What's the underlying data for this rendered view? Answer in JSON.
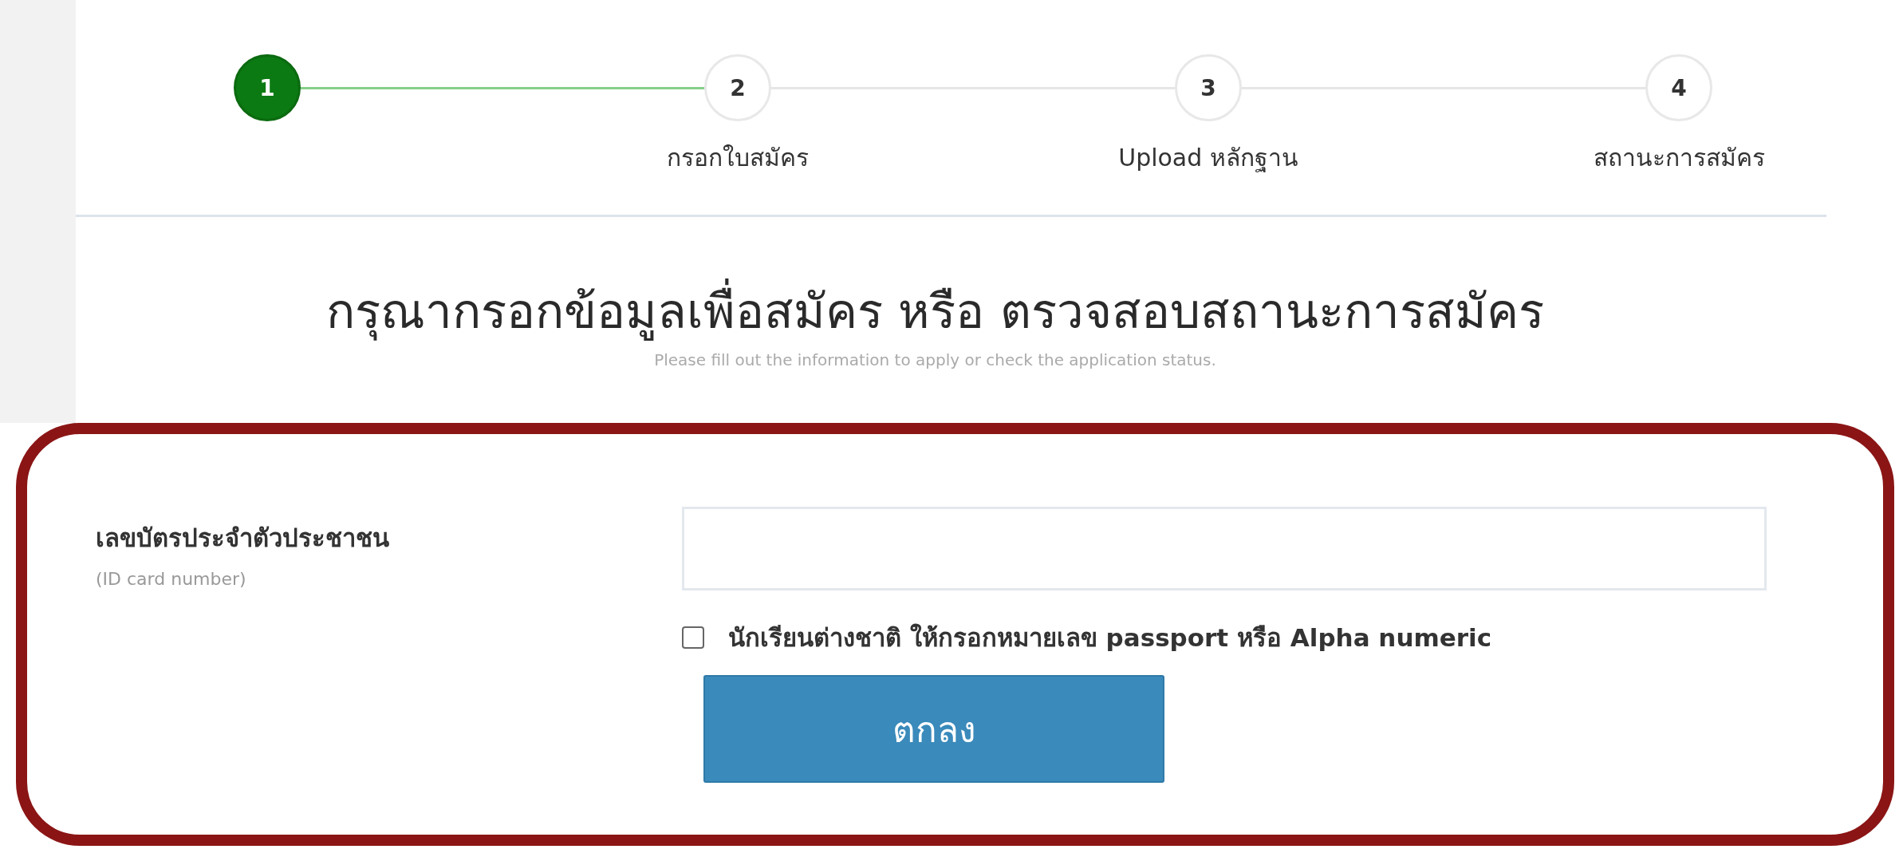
{
  "steps": [
    {
      "number": "1",
      "selected": true
    },
    {
      "number": "2",
      "label": "กรอกใบสมัคร",
      "selected": false
    },
    {
      "number": "3",
      "label": "Upload หลักฐาน",
      "selected": false
    },
    {
      "number": "4",
      "label": "สถานะการสมัคร",
      "selected": false
    }
  ],
  "heading": {
    "title": "กรุณากรอกข้อมูลเพื่อสมัคร หรือ ตรวจสอบสถานะการสมัคร",
    "subtitle": "Please fill out the information to apply or check the application status."
  },
  "form": {
    "field_label": "เลขบัตรประจำตัวประชาชน",
    "field_hint": "(ID card number)",
    "foreign_student": {
      "label": "นักเรียนต่างชาติ ให้กรอกหมายเลข passport หรือ Alpha numeric",
      "checked": false
    },
    "submit": "ตกลง"
  }
}
